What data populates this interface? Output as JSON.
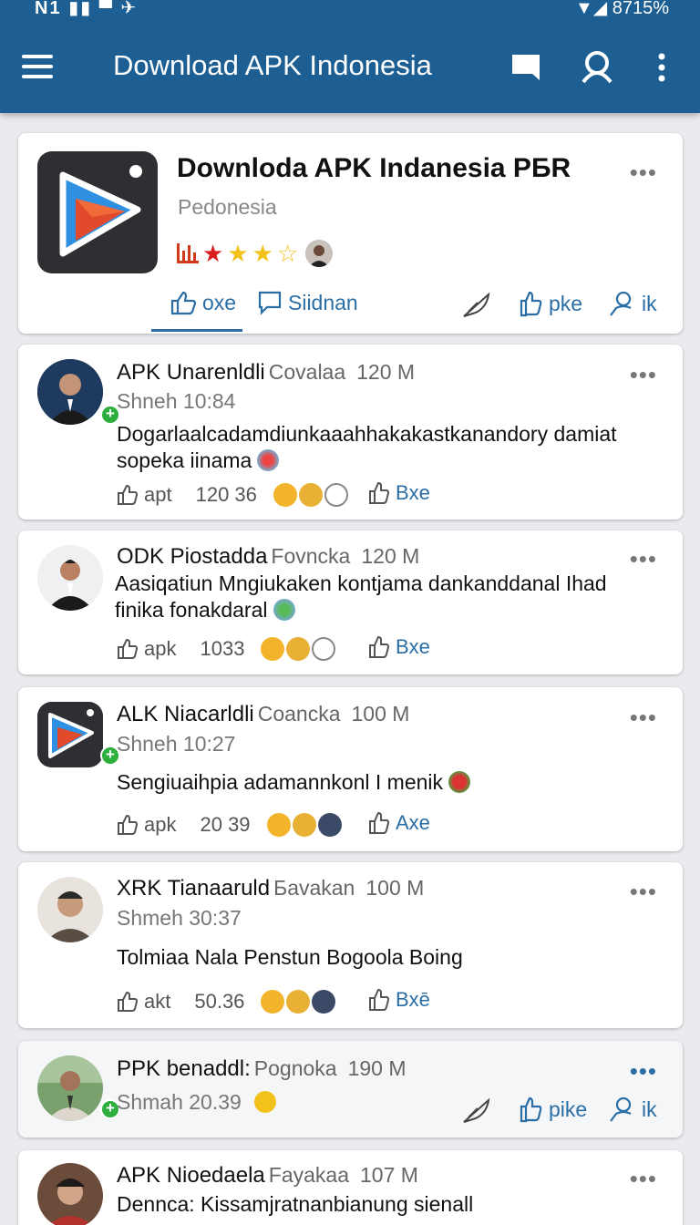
{
  "status": {
    "left": "N1 ▮▮ ▀ ✈",
    "right": "▼◢ 8715%"
  },
  "appbar": {
    "title": "Download APK Indonesia"
  },
  "hero": {
    "title": "Downloda APK Indanesia PБR",
    "subtitle": "Pedonesia",
    "rating": 3.5,
    "actions": {
      "like": "oxe",
      "comment": "Siidnan",
      "share": "pke",
      "share2": "ik"
    }
  },
  "posts": [
    {
      "name": "APK Unarenldli",
      "location": "Covalaa",
      "size": "120 M",
      "time": "Shneh  10:84",
      "text": "Dogarlaalcadamdiunkaaahhakakastkanandory damiat sopeka iinama",
      "like": "apt",
      "count": "120 36",
      "reply": "Bxe"
    },
    {
      "name": "ODK Piostadda",
      "location": "Fovncka",
      "size": "120 M",
      "time": "",
      "text": "Aasiqatiun Mngiukaken kontjama dankanddanal Ihad finika fonakdaral",
      "like": "apk",
      "count": "1033",
      "reply": "Bxe"
    },
    {
      "name": "ALK Niacarldli",
      "location": "Coancka",
      "size": "100 M",
      "time": "Shneh  10:27",
      "text": "Sengiuaihpia adamannkonl I menik",
      "like": "apk",
      "count": "20 39",
      "reply": "Axe"
    },
    {
      "name": "XRK Tianaaruld",
      "location": "Бavakan",
      "size": "100 M",
      "time": "Shmeh  30:37",
      "text": "Tolmiaa Nala Penstun Bogoola Boing",
      "like": "akt",
      "count": "50.36",
      "reply": "Bxē"
    },
    {
      "name": "PPK benaddl:",
      "location": "Pognoka",
      "size": "190 M",
      "time": "Shmah  20.39",
      "share": "pike",
      "share2": "ik"
    },
    {
      "name": "APK Nioedaela",
      "location": "Fayakaa",
      "size": "107 M",
      "text": "Dennca: Kissamjratnanbianung sienall"
    }
  ]
}
